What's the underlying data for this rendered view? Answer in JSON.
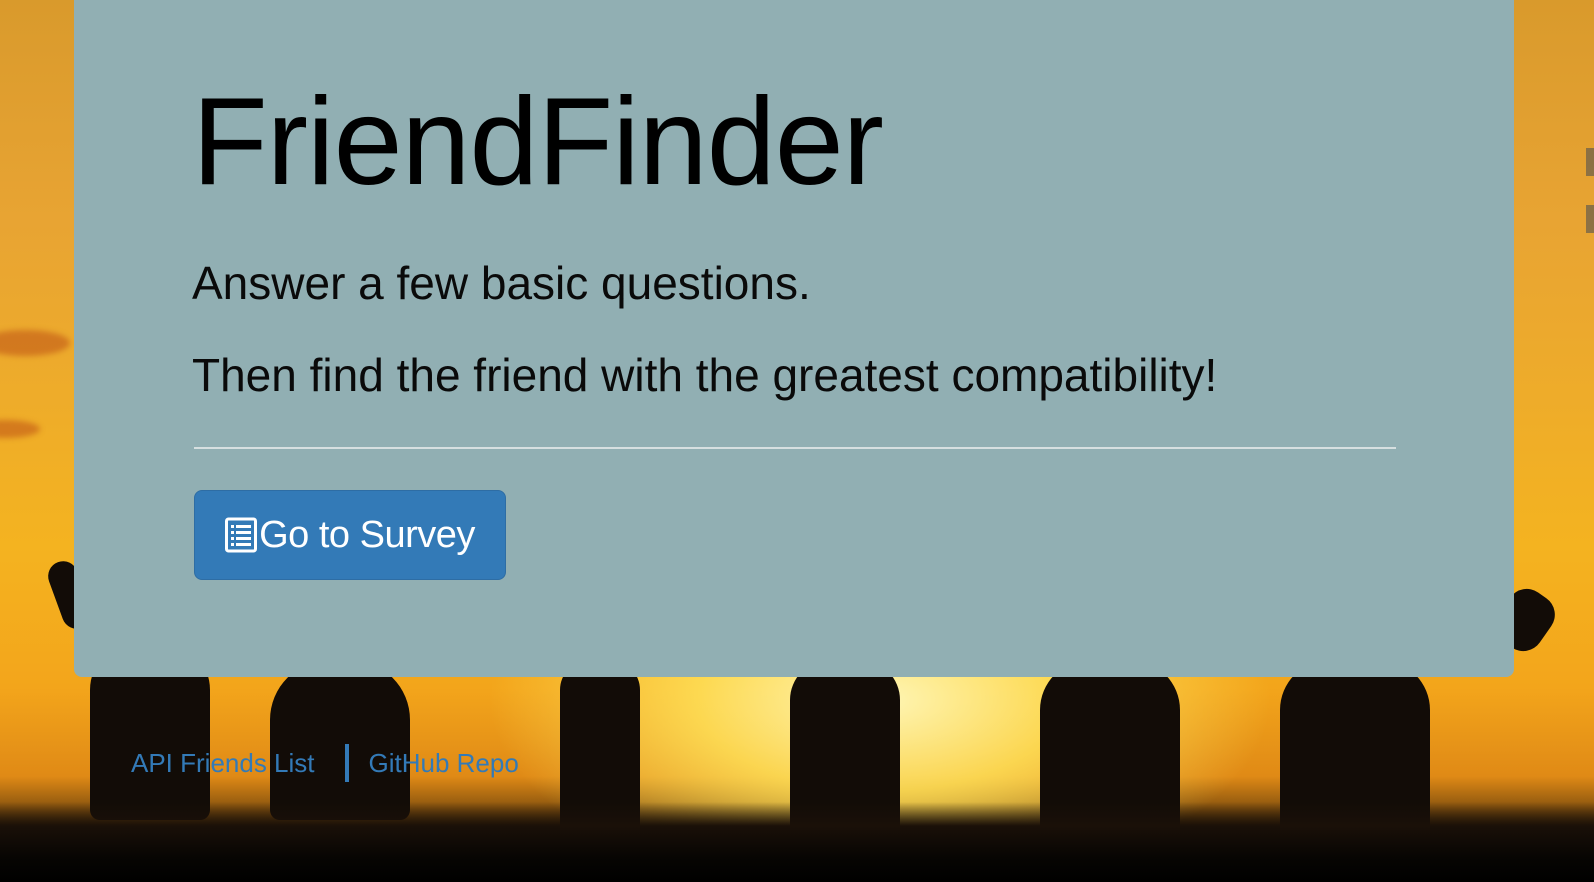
{
  "app": {
    "title": "FriendFinder"
  },
  "jumbotron": {
    "title": "FriendFinder",
    "lead_1": "Answer a few basic questions.",
    "lead_2": "Then find the friend with the greatest compatibility!",
    "button": {
      "label": "Go to Survey",
      "icon": "list-alt-icon"
    }
  },
  "footer": {
    "links": [
      {
        "label": "API Friends List"
      },
      {
        "label": "GitHub Repo"
      }
    ]
  },
  "colors": {
    "panel": "#91afb3",
    "primary": "#337ab7",
    "link": "#337ab7"
  }
}
